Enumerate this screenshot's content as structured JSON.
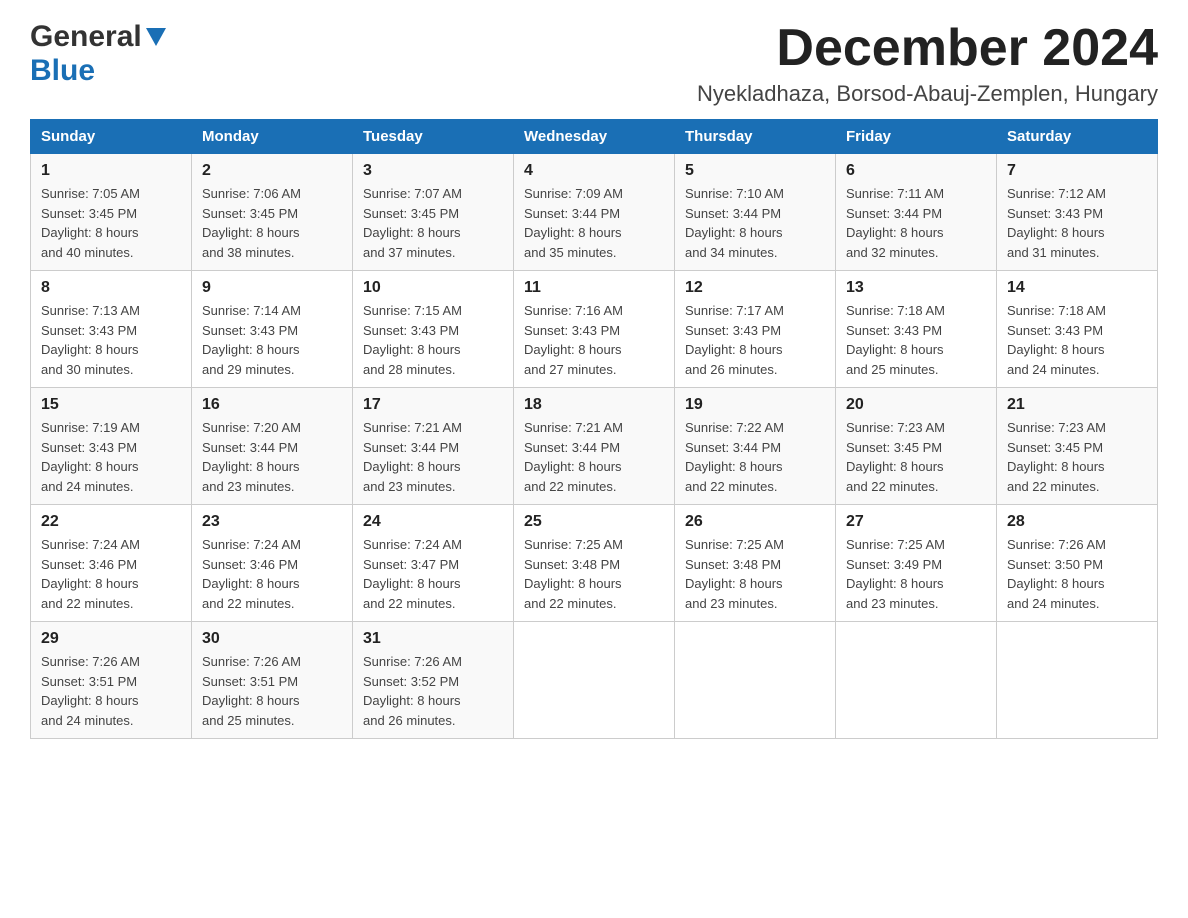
{
  "logo": {
    "general": "General",
    "blue": "Blue",
    "triangle_alt": "logo triangle"
  },
  "title": {
    "month_year": "December 2024",
    "location": "Nyekladhaza, Borsod-Abauj-Zemplen, Hungary"
  },
  "header_days": [
    "Sunday",
    "Monday",
    "Tuesday",
    "Wednesday",
    "Thursday",
    "Friday",
    "Saturday"
  ],
  "weeks": [
    [
      {
        "day": "1",
        "sunrise": "7:05 AM",
        "sunset": "3:45 PM",
        "daylight": "8 hours and 40 minutes."
      },
      {
        "day": "2",
        "sunrise": "7:06 AM",
        "sunset": "3:45 PM",
        "daylight": "8 hours and 38 minutes."
      },
      {
        "day": "3",
        "sunrise": "7:07 AM",
        "sunset": "3:45 PM",
        "daylight": "8 hours and 37 minutes."
      },
      {
        "day": "4",
        "sunrise": "7:09 AM",
        "sunset": "3:44 PM",
        "daylight": "8 hours and 35 minutes."
      },
      {
        "day": "5",
        "sunrise": "7:10 AM",
        "sunset": "3:44 PM",
        "daylight": "8 hours and 34 minutes."
      },
      {
        "day": "6",
        "sunrise": "7:11 AM",
        "sunset": "3:44 PM",
        "daylight": "8 hours and 32 minutes."
      },
      {
        "day": "7",
        "sunrise": "7:12 AM",
        "sunset": "3:43 PM",
        "daylight": "8 hours and 31 minutes."
      }
    ],
    [
      {
        "day": "8",
        "sunrise": "7:13 AM",
        "sunset": "3:43 PM",
        "daylight": "8 hours and 30 minutes."
      },
      {
        "day": "9",
        "sunrise": "7:14 AM",
        "sunset": "3:43 PM",
        "daylight": "8 hours and 29 minutes."
      },
      {
        "day": "10",
        "sunrise": "7:15 AM",
        "sunset": "3:43 PM",
        "daylight": "8 hours and 28 minutes."
      },
      {
        "day": "11",
        "sunrise": "7:16 AM",
        "sunset": "3:43 PM",
        "daylight": "8 hours and 27 minutes."
      },
      {
        "day": "12",
        "sunrise": "7:17 AM",
        "sunset": "3:43 PM",
        "daylight": "8 hours and 26 minutes."
      },
      {
        "day": "13",
        "sunrise": "7:18 AM",
        "sunset": "3:43 PM",
        "daylight": "8 hours and 25 minutes."
      },
      {
        "day": "14",
        "sunrise": "7:18 AM",
        "sunset": "3:43 PM",
        "daylight": "8 hours and 24 minutes."
      }
    ],
    [
      {
        "day": "15",
        "sunrise": "7:19 AM",
        "sunset": "3:43 PM",
        "daylight": "8 hours and 24 minutes."
      },
      {
        "day": "16",
        "sunrise": "7:20 AM",
        "sunset": "3:44 PM",
        "daylight": "8 hours and 23 minutes."
      },
      {
        "day": "17",
        "sunrise": "7:21 AM",
        "sunset": "3:44 PM",
        "daylight": "8 hours and 23 minutes."
      },
      {
        "day": "18",
        "sunrise": "7:21 AM",
        "sunset": "3:44 PM",
        "daylight": "8 hours and 22 minutes."
      },
      {
        "day": "19",
        "sunrise": "7:22 AM",
        "sunset": "3:44 PM",
        "daylight": "8 hours and 22 minutes."
      },
      {
        "day": "20",
        "sunrise": "7:23 AM",
        "sunset": "3:45 PM",
        "daylight": "8 hours and 22 minutes."
      },
      {
        "day": "21",
        "sunrise": "7:23 AM",
        "sunset": "3:45 PM",
        "daylight": "8 hours and 22 minutes."
      }
    ],
    [
      {
        "day": "22",
        "sunrise": "7:24 AM",
        "sunset": "3:46 PM",
        "daylight": "8 hours and 22 minutes."
      },
      {
        "day": "23",
        "sunrise": "7:24 AM",
        "sunset": "3:46 PM",
        "daylight": "8 hours and 22 minutes."
      },
      {
        "day": "24",
        "sunrise": "7:24 AM",
        "sunset": "3:47 PM",
        "daylight": "8 hours and 22 minutes."
      },
      {
        "day": "25",
        "sunrise": "7:25 AM",
        "sunset": "3:48 PM",
        "daylight": "8 hours and 22 minutes."
      },
      {
        "day": "26",
        "sunrise": "7:25 AM",
        "sunset": "3:48 PM",
        "daylight": "8 hours and 23 minutes."
      },
      {
        "day": "27",
        "sunrise": "7:25 AM",
        "sunset": "3:49 PM",
        "daylight": "8 hours and 23 minutes."
      },
      {
        "day": "28",
        "sunrise": "7:26 AM",
        "sunset": "3:50 PM",
        "daylight": "8 hours and 24 minutes."
      }
    ],
    [
      {
        "day": "29",
        "sunrise": "7:26 AM",
        "sunset": "3:51 PM",
        "daylight": "8 hours and 24 minutes."
      },
      {
        "day": "30",
        "sunrise": "7:26 AM",
        "sunset": "3:51 PM",
        "daylight": "8 hours and 25 minutes."
      },
      {
        "day": "31",
        "sunrise": "7:26 AM",
        "sunset": "3:52 PM",
        "daylight": "8 hours and 26 minutes."
      },
      null,
      null,
      null,
      null
    ]
  ],
  "labels": {
    "sunrise": "Sunrise:",
    "sunset": "Sunset:",
    "daylight": "Daylight:"
  }
}
